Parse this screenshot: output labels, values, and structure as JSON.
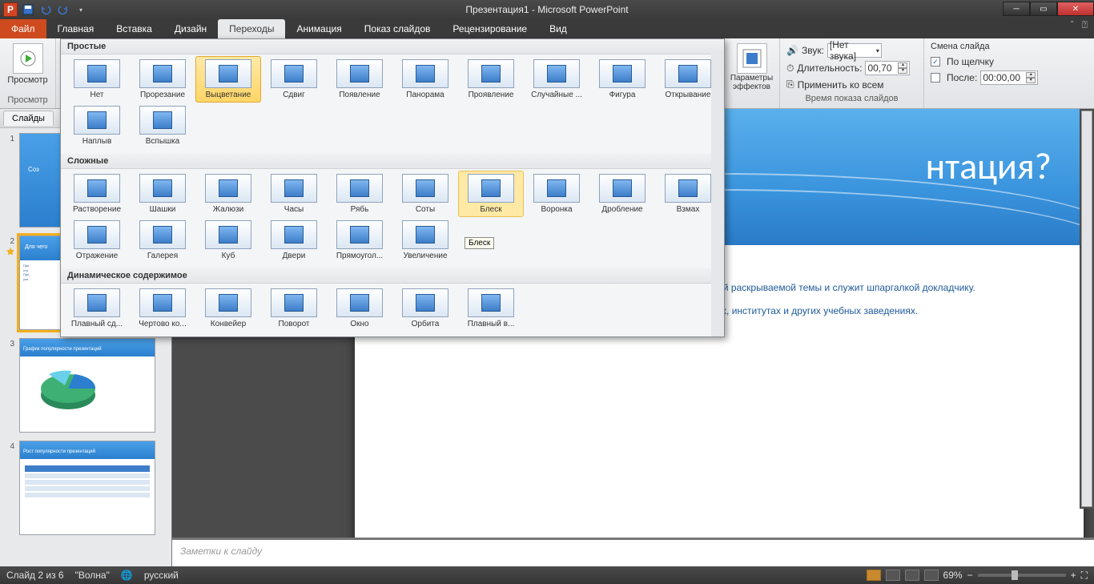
{
  "window": {
    "title": "Презентация1 - Microsoft PowerPoint",
    "app_letter": "P"
  },
  "tabs": {
    "file": "Файл",
    "home": "Главная",
    "insert": "Вставка",
    "design": "Дизайн",
    "transitions": "Переходы",
    "animations": "Анимация",
    "slideshow": "Показ слайдов",
    "review": "Рецензирование",
    "view": "Вид"
  },
  "ribbon": {
    "preview": "Просмотр",
    "preview_group": "Просмотр",
    "params": "Параметры\nэффектов",
    "sound_label": "Звук:",
    "sound_value": "[Нет звука]",
    "duration_label": "Длительность:",
    "duration_value": "00,70",
    "apply_all": "Применить ко всем",
    "timing_group": "Время показа слайдов",
    "advance_title": "Смена слайда",
    "on_click": "По щелчку",
    "after_label": "После:",
    "after_value": "00:00,00"
  },
  "gallery": {
    "simple_head": "Простые",
    "simple": [
      {
        "label": "Нет"
      },
      {
        "label": "Прорезание"
      },
      {
        "label": "Выцветание",
        "selected": true
      },
      {
        "label": "Сдвиг"
      },
      {
        "label": "Появление"
      },
      {
        "label": "Панорама"
      },
      {
        "label": "Проявление"
      },
      {
        "label": "Случайные ..."
      },
      {
        "label": "Фигура"
      },
      {
        "label": "Открывание"
      },
      {
        "label": "Наплыв"
      },
      {
        "label": "Вспышка"
      }
    ],
    "complex_head": "Сложные",
    "complex": [
      {
        "label": "Растворение"
      },
      {
        "label": "Шашки"
      },
      {
        "label": "Жалюзи"
      },
      {
        "label": "Часы"
      },
      {
        "label": "Рябь"
      },
      {
        "label": "Соты"
      },
      {
        "label": "Блеск",
        "hover": true
      },
      {
        "label": "Воронка"
      },
      {
        "label": "Дробление"
      },
      {
        "label": "Взмах"
      },
      {
        "label": "Отражение"
      },
      {
        "label": "Галерея"
      },
      {
        "label": "Куб"
      },
      {
        "label": "Двери"
      },
      {
        "label": "Прямоугол..."
      },
      {
        "label": "Увеличение"
      }
    ],
    "dynamic_head": "Динамическое содержимое",
    "dynamic": [
      {
        "label": "Плавный сд..."
      },
      {
        "label": "Чертово ко..."
      },
      {
        "label": "Конвейер"
      },
      {
        "label": "Поворот"
      },
      {
        "label": "Окно"
      },
      {
        "label": "Орбита"
      },
      {
        "label": "Плавный в..."
      }
    ],
    "tooltip": "Блеск"
  },
  "slidepanel": {
    "tab": "Слайды",
    "nums": [
      "1",
      "2",
      "3",
      "4"
    ],
    "t2_title": "Для чего",
    "t3_title": "График популярности презентаций",
    "t4_title": "Рост популярности презентаций"
  },
  "slide": {
    "title_frag": "нтация?",
    "line1": "диторией раскрываемой темы и служит шпаргалкой докладчику.",
    "line2": "Применяются не только в бизнесе, но и сфере образования в школах, институтах и других учебных заведениях."
  },
  "notes_placeholder": "Заметки к слайду",
  "status": {
    "slide": "Слайд 2 из 6",
    "theme": "\"Волна\"",
    "lang": "русский",
    "zoom": "69%"
  }
}
